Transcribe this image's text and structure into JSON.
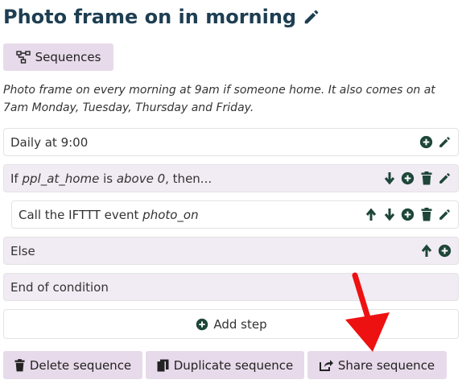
{
  "title": "Photo frame on in morning",
  "sequences_button": "Sequences",
  "description": "Photo frame on every morning at 9am if someone home. It also comes on at 7am Monday, Tuesday, Thursday and Friday.",
  "steps": [
    {
      "text": "Daily at 9:00"
    },
    {
      "prefix": "If ",
      "variable": "ppl_at_home",
      "middle": " is ",
      "comparator": "above 0",
      "suffix": ", then..."
    },
    {
      "prefix": "Call the IFTTT event ",
      "event": "photo_on"
    },
    {
      "text": "Else"
    },
    {
      "text": "End of condition"
    }
  ],
  "add_step": "Add step",
  "actions": {
    "delete": "Delete sequence",
    "duplicate": "Duplicate sequence",
    "share": "Share sequence"
  },
  "colors": {
    "title": "#1e3e52",
    "icon": "#1e4639",
    "button_bg": "#e7daea",
    "row_tint": "#f1ebf4",
    "annotation_arrow": "#ee1111"
  }
}
